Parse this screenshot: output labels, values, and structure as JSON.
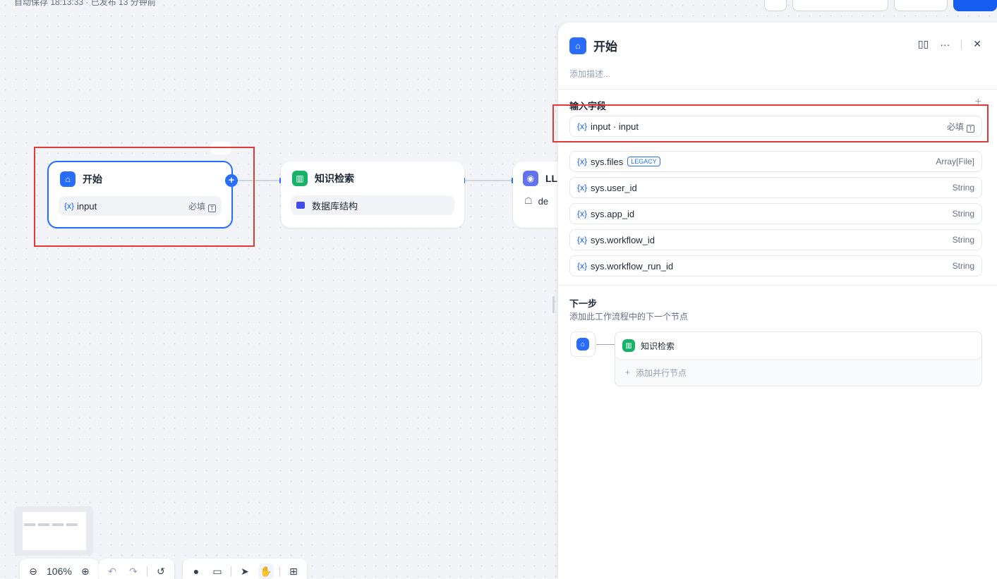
{
  "topbar": {
    "status": "自动保存 18:13:33 · 已发布 13 分钟前"
  },
  "canvas": {
    "start_node": {
      "title": "开始",
      "var_prefix": "{x}",
      "var_name": "input",
      "required": "必填"
    },
    "kb_node": {
      "title": "知识检索",
      "dataset": "数据库结构"
    },
    "llm_node": {
      "title": "LL",
      "model_prefix": "de"
    },
    "more_label": "···"
  },
  "toolbar": {
    "zoom": "106%"
  },
  "panel": {
    "title": "开始",
    "description_placeholder": "添加描述...",
    "input_section": "输入字段",
    "fields": [
      {
        "prefix": "{x}",
        "name": "input · input",
        "type": "必填"
      },
      {
        "prefix": "{x}",
        "name": "sys.files",
        "badge": "LEGACY",
        "type": "Array[File]"
      },
      {
        "prefix": "{x}",
        "name": "sys.user_id",
        "type": "String"
      },
      {
        "prefix": "{x}",
        "name": "sys.app_id",
        "type": "String"
      },
      {
        "prefix": "{x}",
        "name": "sys.workflow_id",
        "type": "String"
      },
      {
        "prefix": "{x}",
        "name": "sys.workflow_run_id",
        "type": "String"
      }
    ],
    "next_step": {
      "title": "下一步",
      "description": "添加此工作流程中的下一个节点",
      "next_node": "知识检索",
      "add_parallel": "添加并行节点"
    }
  },
  "colors": {
    "accent": "#296dff",
    "highlight": "#e53935",
    "kb": "#17b26a",
    "llm": "#6172f3"
  },
  "icons": [
    "home-icon",
    "book-icon",
    "brain-icon",
    "folder-icon",
    "zoom-out-icon",
    "zoom-in-icon",
    "undo-icon",
    "redo-icon",
    "history-icon",
    "add-node-icon",
    "note-icon",
    "pointer-icon",
    "hand-icon",
    "layout-icon",
    "panel-toggle-icon",
    "more-icon",
    "close-icon",
    "plus-icon"
  ]
}
